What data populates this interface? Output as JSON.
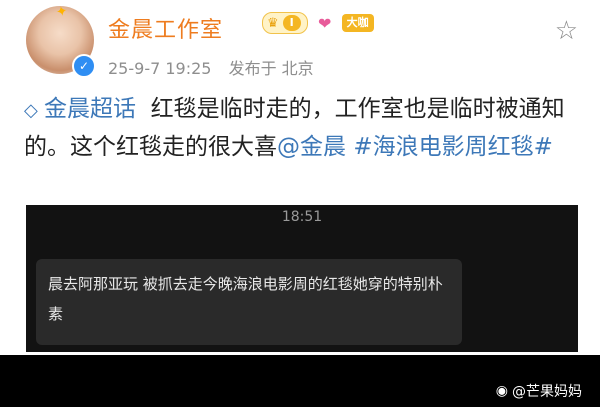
{
  "post": {
    "author": "金晨工作室",
    "level_label": "I",
    "size_badge": "大咖",
    "date": "25-9-7 19:25",
    "location": "发布于 北京",
    "topic": "金晨超话",
    "text_1": "红毯是临时走的，工作室也是临时被通知的。这个红毯走的很大喜",
    "mention": "@金晨",
    "hashtag": "#海浪电影周红毯#"
  },
  "chat": {
    "time": "18:51",
    "message": "晨去阿那亚玩  被抓去走今晚海浪电影周的红毯她穿的特别朴素"
  },
  "watermark": {
    "text": "@芒果妈妈"
  },
  "icons": {
    "star": "star-outline-icon",
    "crown": "crown-icon",
    "heart": "heart-badge-icon",
    "verified": "verified-icon",
    "topic": "diamond-topic-icon"
  }
}
